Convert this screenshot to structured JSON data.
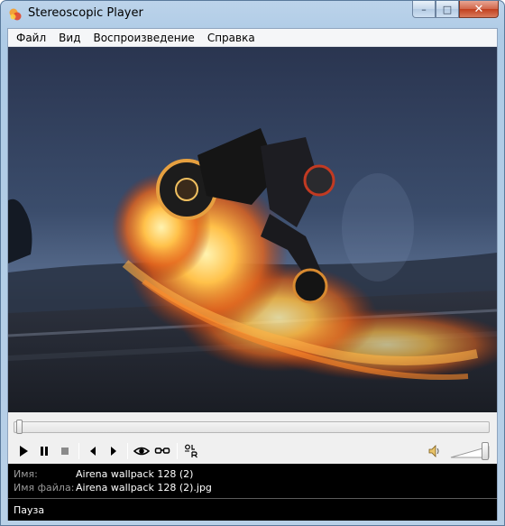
{
  "window": {
    "title": "Stereoscopic Player"
  },
  "caption": {
    "minimize": "–",
    "maximize": "□",
    "close": "✕"
  },
  "menu": [
    {
      "label": "Файл"
    },
    {
      "label": "Вид"
    },
    {
      "label": "Воспроизведение"
    },
    {
      "label": "Справка"
    }
  ],
  "playback": {
    "position_fraction": 0.0,
    "volume_fraction": 1.0
  },
  "controls": {
    "icons": [
      "play-icon",
      "pause-icon",
      "stop-icon",
      "previous-icon",
      "next-icon",
      "view-eye-icon",
      "glasses-icon",
      "left-right-layout-icon",
      "speaker-icon"
    ]
  },
  "info": {
    "name_label": "Имя:",
    "name_value": "Airena wallpack 128 (2)",
    "file_label": "Имя файла:",
    "file_value": "Airena wallpack 128 (2).jpg"
  },
  "status": {
    "text": "Пауза"
  },
  "colors": {
    "accent_flame": "#ffb347",
    "video_sky": "#26334d",
    "close_button": "#c1401e"
  }
}
